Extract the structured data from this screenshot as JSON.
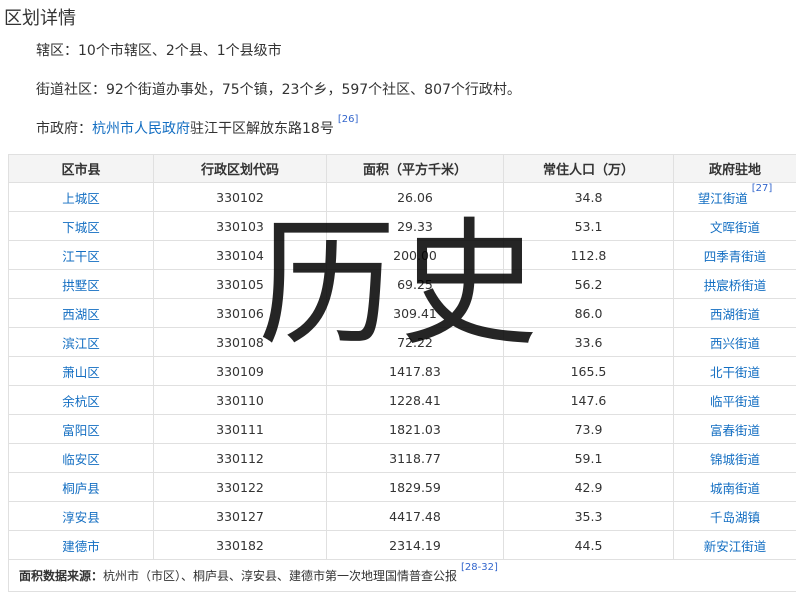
{
  "title": "区划详情",
  "lines": {
    "jurisdiction": "辖区：10个市辖区、2个县、1个县级市",
    "streets": "街道社区：92个街道办事处，75个镇，23个乡，597个社区、807个行政村。",
    "gov_label": "市政府：",
    "gov_link": "杭州市人民政府",
    "gov_rest": "驻江干区解放东路18号",
    "gov_ref": "[26]"
  },
  "table": {
    "headers": [
      "区市县",
      "行政区划代码",
      "面积（平方千米）",
      "常住人口（万）",
      "政府驻地"
    ],
    "rows": [
      {
        "name": "上城区",
        "code": "330102",
        "area": "26.06",
        "pop": "34.8",
        "seat": "望江街道",
        "ref": "[27]"
      },
      {
        "name": "下城区",
        "code": "330103",
        "area": "29.33",
        "pop": "53.1",
        "seat": "文晖街道",
        "ref": ""
      },
      {
        "name": "江干区",
        "code": "330104",
        "area": "200.00",
        "pop": "112.8",
        "seat": "四季青街道",
        "ref": ""
      },
      {
        "name": "拱墅区",
        "code": "330105",
        "area": "69.25",
        "pop": "56.2",
        "seat": "拱宸桥街道",
        "ref": ""
      },
      {
        "name": "西湖区",
        "code": "330106",
        "area": "309.41",
        "pop": "86.0",
        "seat": "西湖街道",
        "ref": ""
      },
      {
        "name": "滨江区",
        "code": "330108",
        "area": "72.22",
        "pop": "33.6",
        "seat": "西兴街道",
        "ref": ""
      },
      {
        "name": "萧山区",
        "code": "330109",
        "area": "1417.83",
        "pop": "165.5",
        "seat": "北干街道",
        "ref": ""
      },
      {
        "name": "余杭区",
        "code": "330110",
        "area": "1228.41",
        "pop": "147.6",
        "seat": "临平街道",
        "ref": ""
      },
      {
        "name": "富阳区",
        "code": "330111",
        "area": "1821.03",
        "pop": "73.9",
        "seat": "富春街道",
        "ref": ""
      },
      {
        "name": "临安区",
        "code": "330112",
        "area": "3118.77",
        "pop": "59.1",
        "seat": "锦城街道",
        "ref": ""
      },
      {
        "name": "桐庐县",
        "code": "330122",
        "area": "1829.59",
        "pop": "42.9",
        "seat": "城南街道",
        "ref": ""
      },
      {
        "name": "淳安县",
        "code": "330127",
        "area": "4417.48",
        "pop": "35.3",
        "seat": "千岛湖镇",
        "ref": ""
      },
      {
        "name": "建德市",
        "code": "330182",
        "area": "2314.19",
        "pop": "44.5",
        "seat": "新安江街道",
        "ref": ""
      }
    ],
    "footer_label": "面积数据来源：",
    "footer_text": "杭州市（市区）、桐庐县、淳安县、建德市第一次地理国情普查公报",
    "footer_ref": "[28-32]"
  },
  "watermark": "历史"
}
